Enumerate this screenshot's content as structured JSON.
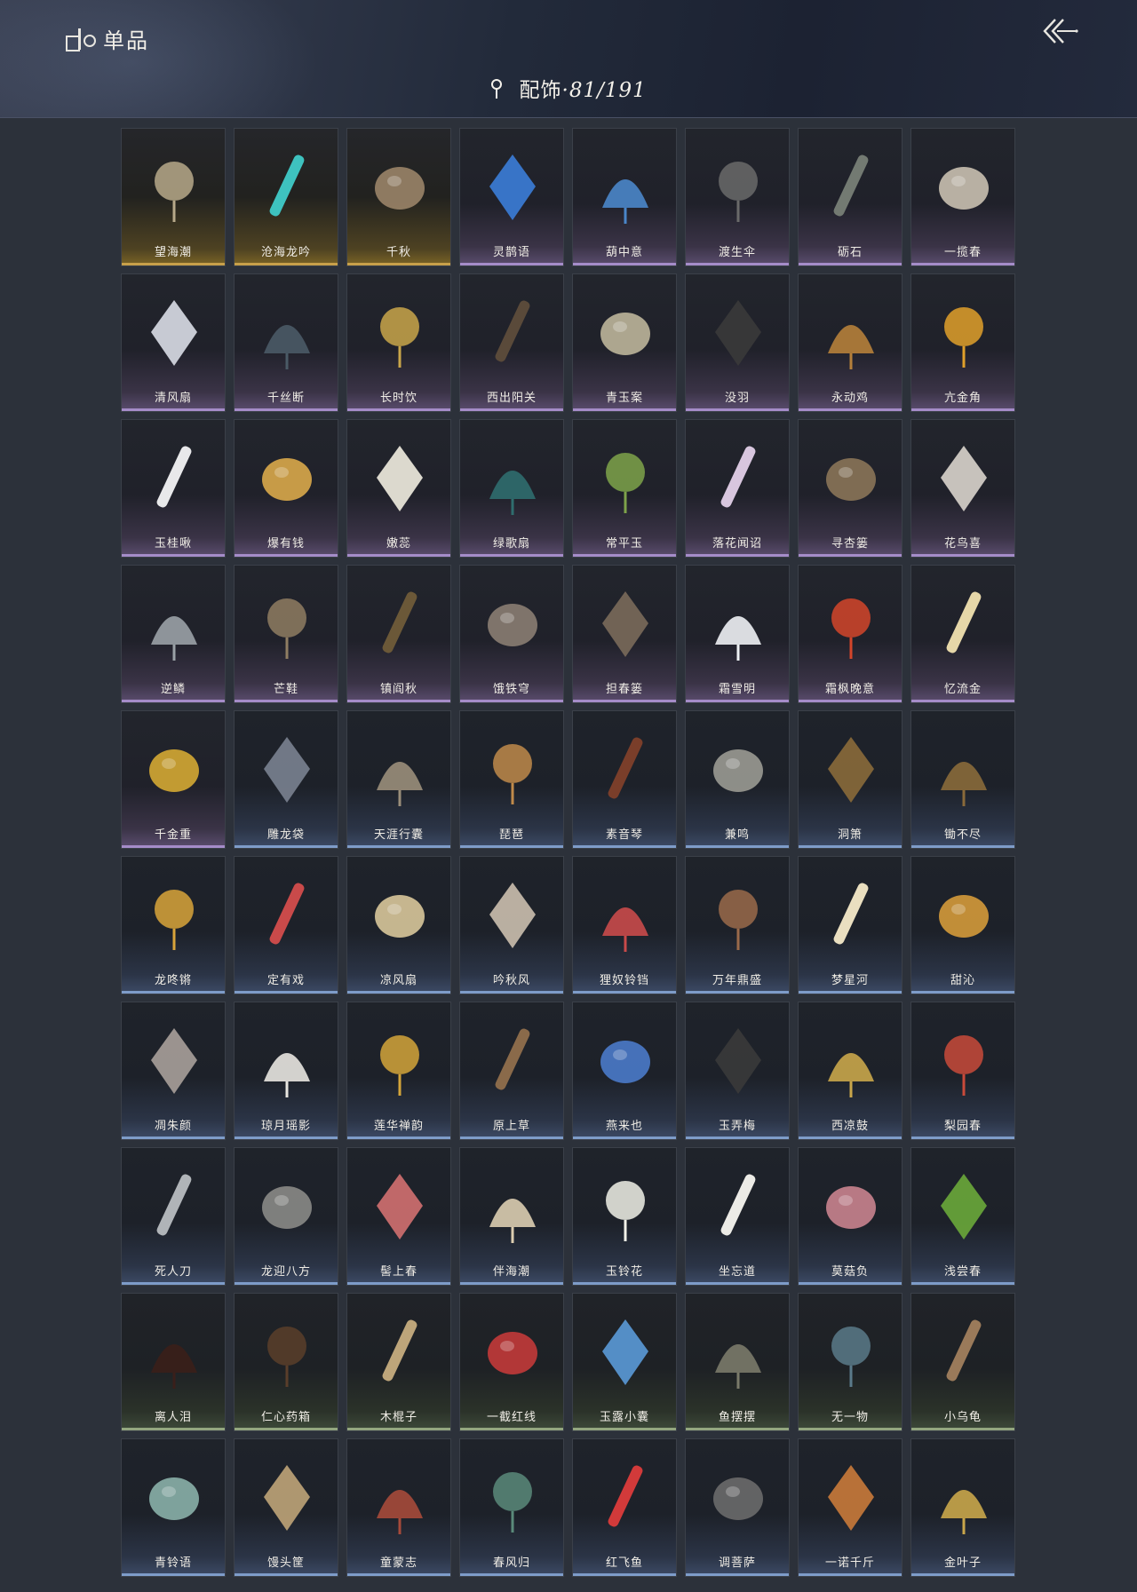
{
  "header": {
    "title": "单品",
    "logo_icon": "collection-logo-icon",
    "back_icon": "double-chevron-back-icon",
    "category_icon": "location-pin-icon",
    "category_label": "配饰",
    "category_count": "·81/191"
  },
  "tier_colors": {
    "gold": "#c7a04a",
    "purple": "#a58cc9",
    "blue": "#7e9cc9",
    "green": "#93a67f"
  },
  "items": [
    {
      "label": "望海潮",
      "tier": "gold",
      "icon": "dragon-ornament-icon",
      "color": "#b7a98a"
    },
    {
      "label": "沧海龙吟",
      "tier": "gold",
      "icon": "coral-icon",
      "color": "#3ec2bf"
    },
    {
      "label": "千秋",
      "tier": "gold",
      "icon": "tassel-net-icon",
      "color": "#9a8468"
    },
    {
      "label": "灵鹊语",
      "tier": "purple",
      "icon": "magpie-pendant-icon",
      "color": "#3b7dd8"
    },
    {
      "label": "葫中意",
      "tier": "purple",
      "icon": "gourd-pendant-icon",
      "color": "#4a86c9"
    },
    {
      "label": "渡生伞",
      "tier": "purple",
      "icon": "folded-umbrella-icon",
      "color": "#6a6a6a"
    },
    {
      "label": "砺石",
      "tier": "purple",
      "icon": "stone-blade-icon",
      "color": "#737a72"
    },
    {
      "label": "一揽春",
      "tier": "purple",
      "icon": "flower-basket-staff-icon",
      "color": "#c9c0b0"
    },
    {
      "label": "清风扇",
      "tier": "purple",
      "icon": "round-fan-icon",
      "color": "#d9dde6"
    },
    {
      "label": "千丝断",
      "tier": "purple",
      "icon": "flute-icon",
      "color": "#4a5a66"
    },
    {
      "label": "长时饮",
      "tier": "purple",
      "icon": "teapot-icon",
      "color": "#c9a64a"
    },
    {
      "label": "西出阳关",
      "tier": "purple",
      "icon": "wine-gourd-icon",
      "color": "#5a4a3a"
    },
    {
      "label": "青玉案",
      "tier": "purple",
      "icon": "scroll-bundle-icon",
      "color": "#bdb59a"
    },
    {
      "label": "没羽",
      "tier": "purple",
      "icon": "quiver-icon",
      "color": "#3a3a3a"
    },
    {
      "label": "永动鸡",
      "tier": "purple",
      "icon": "rooster-icon",
      "color": "#b5803a"
    },
    {
      "label": "亢金角",
      "tier": "purple",
      "icon": "golden-horns-icon",
      "color": "#e0a02a"
    },
    {
      "label": "玉桂啾",
      "tier": "purple",
      "icon": "bird-branch-icon",
      "color": "#e8e8ea"
    },
    {
      "label": "爆有钱",
      "tier": "purple",
      "icon": "sparkle-coins-icon",
      "color": "#d9a94a"
    },
    {
      "label": "嫩蕊",
      "tier": "purple",
      "icon": "white-flower-icon",
      "color": "#f1ede0"
    },
    {
      "label": "绿歌扇",
      "tier": "purple",
      "icon": "green-round-fan-icon",
      "color": "#2f6d6e"
    },
    {
      "label": "常平玉",
      "tier": "purple",
      "icon": "jade-pendant-icon",
      "color": "#7ea34a"
    },
    {
      "label": "落花闻诏",
      "tier": "purple",
      "icon": "flower-pendant-icon",
      "color": "#d8c6de"
    },
    {
      "label": "寻杏篓",
      "tier": "purple",
      "icon": "wicker-basket-icon",
      "color": "#8a7458"
    },
    {
      "label": "花鸟喜",
      "tier": "purple",
      "icon": "bird-kite-icon",
      "color": "#d9d4cc"
    },
    {
      "label": "逆鳞",
      "tier": "purple",
      "icon": "metal-rod-icon",
      "color": "#9aa1a6"
    },
    {
      "label": "芒鞋",
      "tier": "purple",
      "icon": "straw-sandals-icon",
      "color": "#8f7d62"
    },
    {
      "label": "镇阎秋",
      "tier": "purple",
      "icon": "carved-rod-icon",
      "color": "#6b5838"
    },
    {
      "label": "饿铁穹",
      "tier": "purple",
      "icon": "torn-flag-icon",
      "color": "#8a7d72"
    },
    {
      "label": "担春篓",
      "tier": "purple",
      "icon": "vegetable-basket-icon",
      "color": "#7a6a5a"
    },
    {
      "label": "霜雪明",
      "tier": "purple",
      "icon": "snowflake-icon",
      "color": "#eef1f4"
    },
    {
      "label": "霜枫晚意",
      "tier": "purple",
      "icon": "maple-leaves-icon",
      "color": "#d4452a"
    },
    {
      "label": "忆流金",
      "tier": "purple",
      "icon": "flower-blade-icon",
      "color": "#e6d7a8"
    },
    {
      "label": "千金重",
      "tier": "purple",
      "icon": "golden-bird-icon",
      "color": "#d4a833"
    },
    {
      "label": "雕龙袋",
      "tier": "blue",
      "icon": "birdcage-icon",
      "color": "#7a8290"
    },
    {
      "label": "天涯行囊",
      "tier": "blue",
      "icon": "travel-pack-icon",
      "color": "#9a8e7a"
    },
    {
      "label": "琵琶",
      "tier": "blue",
      "icon": "pipa-icon",
      "color": "#c08a4a"
    },
    {
      "label": "素音琴",
      "tier": "blue",
      "icon": "zither-icon",
      "color": "#7a3e2a"
    },
    {
      "label": "兼鸣",
      "tier": "blue",
      "icon": "hex-lantern-icon",
      "color": "#9a9a92"
    },
    {
      "label": "洞箫",
      "tier": "blue",
      "icon": "bamboo-flute-icon",
      "color": "#8a6a3a"
    },
    {
      "label": "锄不尽",
      "tier": "blue",
      "icon": "hoe-icon",
      "color": "#8a6a3a"
    },
    {
      "label": "龙咚锵",
      "tier": "blue",
      "icon": "lion-drum-icon",
      "color": "#d9a43a"
    },
    {
      "label": "定有戏",
      "tier": "blue",
      "icon": "opera-spear-icon",
      "color": "#c94a4a"
    },
    {
      "label": "凉风扇",
      "tier": "blue",
      "icon": "painted-fan-icon",
      "color": "#d8c69a"
    },
    {
      "label": "吟秋风",
      "tier": "blue",
      "icon": "palm-leaf-fan-icon",
      "color": "#cbbfae"
    },
    {
      "label": "狸奴铃铛",
      "tier": "blue",
      "icon": "cat-bell-icon",
      "color": "#c94a4a"
    },
    {
      "label": "万年鼎盛",
      "tier": "blue",
      "icon": "bronze-cauldron-icon",
      "color": "#9a6a4a"
    },
    {
      "label": "梦星河",
      "tier": "blue",
      "icon": "flower-boat-icon",
      "color": "#eadfc0"
    },
    {
      "label": "甜沁",
      "tier": "blue",
      "icon": "candied-skewer-icon",
      "color": "#d49a3a"
    },
    {
      "label": "凋朱颜",
      "tier": "blue",
      "icon": "mirror-tassel-icon",
      "color": "#a8a09a"
    },
    {
      "label": "琼月瑶影",
      "tier": "blue",
      "icon": "crescent-pendant-icon",
      "color": "#e8e6e0"
    },
    {
      "label": "莲华禅韵",
      "tier": "blue",
      "icon": "golden-lotus-icon",
      "color": "#d4a53a"
    },
    {
      "label": "原上草",
      "tier": "blue",
      "icon": "hanging-basket-icon",
      "color": "#8a6a4a"
    },
    {
      "label": "燕来也",
      "tier": "blue",
      "icon": "swallow-bowl-icon",
      "color": "#4a7ac9"
    },
    {
      "label": "玉弄梅",
      "tier": "blue",
      "icon": "flute-case-icon",
      "color": "#3a3a3a"
    },
    {
      "label": "西凉鼓",
      "tier": "blue",
      "icon": "hand-drum-icon",
      "color": "#c9a64a"
    },
    {
      "label": "梨园春",
      "tier": "blue",
      "icon": "banner-flags-icon",
      "color": "#c94a3a"
    },
    {
      "label": "死人刀",
      "tier": "blue",
      "icon": "curved-blade-icon",
      "color": "#b0b4b8"
    },
    {
      "label": "龙迎八方",
      "tier": "blue",
      "icon": "dragon-shield-icon",
      "color": "#8a8a86"
    },
    {
      "label": "髻上春",
      "tier": "blue",
      "icon": "peony-icon",
      "color": "#d27070"
    },
    {
      "label": "伴海潮",
      "tier": "blue",
      "icon": "starfish-icon",
      "color": "#dccdb0"
    },
    {
      "label": "玉铃花",
      "tier": "blue",
      "icon": "lily-of-valley-icon",
      "color": "#f1f1e8"
    },
    {
      "label": "坐忘道",
      "tier": "blue",
      "icon": "mask-icon",
      "color": "#ecebe6"
    },
    {
      "label": "莫菇负",
      "tier": "blue",
      "icon": "mushrooms-icon",
      "color": "#c9838e"
    },
    {
      "label": "浅尝春",
      "tier": "blue",
      "icon": "green-fruits-icon",
      "color": "#6aa83a"
    },
    {
      "label": "离人泪",
      "tier": "green",
      "icon": "wine-jar-icon",
      "color": "#3a1f1a"
    },
    {
      "label": "仁心药箱",
      "tier": "green",
      "icon": "medicine-chest-icon",
      "color": "#5a3e2a"
    },
    {
      "label": "木棍子",
      "tier": "green",
      "icon": "wooden-stick-icon",
      "color": "#bda57a"
    },
    {
      "label": "一截红线",
      "tier": "green",
      "icon": "red-cord-icon",
      "color": "#c23a3a"
    },
    {
      "label": "玉露小囊",
      "tier": "green",
      "icon": "blue-pouch-icon",
      "color": "#5a9ad8"
    },
    {
      "label": "鱼摆摆",
      "tier": "green",
      "icon": "fish-icon",
      "color": "#7a7a6a"
    },
    {
      "label": "无一物",
      "tier": "green",
      "icon": "cloth-bag-icon",
      "color": "#5a7a8a"
    },
    {
      "label": "小乌龟",
      "tier": "green",
      "icon": "turtle-icon",
      "color": "#9a7a5a"
    },
    {
      "label": "青铃语",
      "tier": "blue",
      "icon": "wind-bell-icon",
      "color": "#8ab0a8"
    },
    {
      "label": "馒头筐",
      "tier": "blue",
      "icon": "bun-basket-icon",
      "color": "#bfa478"
    },
    {
      "label": "童蒙志",
      "tier": "blue",
      "icon": "crossed-flags-icon",
      "color": "#a64a3a"
    },
    {
      "label": "春风归",
      "tier": "blue",
      "icon": "swallow-kite-icon",
      "color": "#5a8a7a"
    },
    {
      "label": "红飞鱼",
      "tier": "blue",
      "icon": "fish-kite-icon",
      "color": "#d23a3a"
    },
    {
      "label": "调菩萨",
      "tier": "blue",
      "icon": "dagger-set-icon",
      "color": "#6a6a6a"
    },
    {
      "label": "一诺千斤",
      "tier": "blue",
      "icon": "roast-chicken-icon",
      "color": "#c97a3a"
    },
    {
      "label": "金叶子",
      "tier": "blue",
      "icon": "gold-leaf-icon",
      "color": "#c9a64a"
    }
  ]
}
